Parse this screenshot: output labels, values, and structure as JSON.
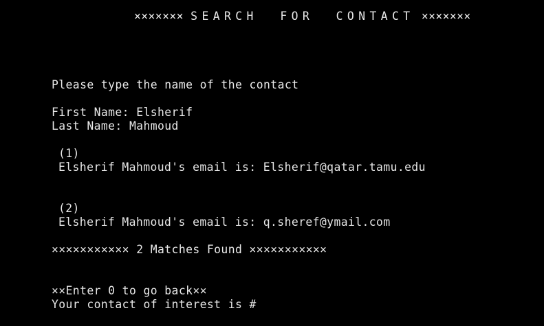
{
  "title": {
    "left_marks": "×××××××",
    "text": "SEARCH  FOR  CONTACT",
    "right_marks": "×××××××"
  },
  "prompt": "Please type the name of the contact",
  "first_name_line": "First Name: Elsherif",
  "last_name_line": "Last Name: Mahmoud",
  "results": [
    {
      "index_label": "(1)",
      "email_line": "Elsherif Mahmoud's email is: Elsherif@qatar.tamu.edu"
    },
    {
      "index_label": "(2)",
      "email_line": "Elsherif Mahmoud's email is: q.sheref@ymail.com"
    }
  ],
  "matches_summary": "××××××××××× 2 Matches Found ×××××××××××",
  "back_hint": "××Enter 0 to go back××",
  "input_prompt": "Your contact of interest is #"
}
